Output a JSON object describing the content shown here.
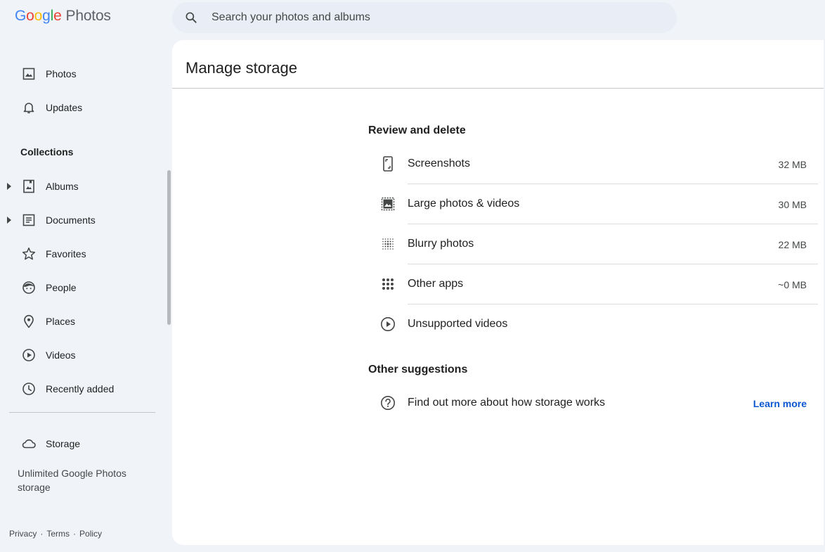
{
  "app": {
    "logo_letters": [
      "G",
      "o",
      "o",
      "g",
      "l",
      "e"
    ],
    "product": "Photos"
  },
  "search": {
    "placeholder": "Search your photos and albums"
  },
  "sidebar": {
    "items": [
      {
        "label": "Photos",
        "icon": "photo-icon"
      },
      {
        "label": "Updates",
        "icon": "bell-icon"
      }
    ],
    "collections_label": "Collections",
    "collections": [
      {
        "label": "Albums",
        "icon": "album-icon",
        "expandable": true
      },
      {
        "label": "Documents",
        "icon": "document-icon",
        "expandable": true
      },
      {
        "label": "Favorites",
        "icon": "star-icon",
        "expandable": false
      },
      {
        "label": "People",
        "icon": "face-icon",
        "expandable": false
      },
      {
        "label": "Places",
        "icon": "pin-icon",
        "expandable": false
      },
      {
        "label": "Videos",
        "icon": "play-icon",
        "expandable": false
      },
      {
        "label": "Recently added",
        "icon": "clock-icon",
        "expandable": false
      }
    ],
    "storage_label": "Storage",
    "storage_note": "Unlimited Google Photos storage",
    "footer": {
      "privacy": "Privacy",
      "terms": "Terms",
      "policy": "Policy",
      "separator": "·"
    }
  },
  "main": {
    "title": "Manage storage",
    "review_title": "Review and delete",
    "review_items": [
      {
        "label": "Screenshots",
        "size": "32 MB",
        "icon": "phone-screenshot-icon"
      },
      {
        "label": "Large photos & videos",
        "size": "30 MB",
        "icon": "large-photo-icon"
      },
      {
        "label": "Blurry photos",
        "size": "22 MB",
        "icon": "blur-icon"
      },
      {
        "label": "Other apps",
        "size": "~0 MB",
        "icon": "apps-grid-icon"
      },
      {
        "label": "Unsupported videos",
        "size": "",
        "icon": "play-circle-icon"
      }
    ],
    "suggestions_title": "Other suggestions",
    "suggestion": {
      "label": "Find out more about how storage works",
      "link": "Learn more",
      "icon": "help-icon"
    }
  },
  "colors": {
    "background": "#f0f4f9",
    "surface": "#ffffff",
    "search_bg": "#e9eef6",
    "link": "#0b57d0",
    "text": "#1f1f1f"
  }
}
